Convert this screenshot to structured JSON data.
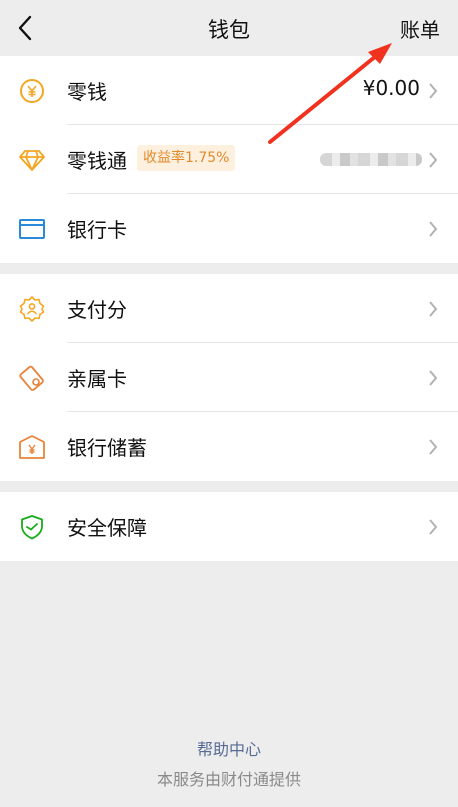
{
  "nav": {
    "title": "钱包",
    "bill_label": "账单",
    "back_icon": "chevron-left-icon"
  },
  "sections": [
    {
      "items": [
        {
          "name": "change",
          "label": "零钱",
          "value": "¥0.00",
          "icon": "yen-coin-icon"
        },
        {
          "name": "licaitong",
          "label": "零钱通",
          "badge": "收益率1.75%",
          "value_blurred": true,
          "icon": "diamond-icon"
        },
        {
          "name": "bank-card",
          "label": "银行卡",
          "icon": "bank-card-icon"
        }
      ]
    },
    {
      "items": [
        {
          "name": "pay-score",
          "label": "支付分",
          "icon": "pay-score-icon"
        },
        {
          "name": "family-card",
          "label": "亲属卡",
          "icon": "family-card-icon"
        },
        {
          "name": "bank-savings",
          "label": "银行储蓄",
          "icon": "bank-savings-icon"
        }
      ]
    },
    {
      "items": [
        {
          "name": "security",
          "label": "安全保障",
          "icon": "shield-icon"
        }
      ]
    }
  ],
  "footer": {
    "help": "帮助中心",
    "note": "本服务由财付通提供"
  },
  "colors": {
    "accent_orange": "#f5a623",
    "shield_green": "#1aad19",
    "card_blue": "#2b8ad8",
    "arrow_red": "#f0321e",
    "link": "#576b95"
  }
}
